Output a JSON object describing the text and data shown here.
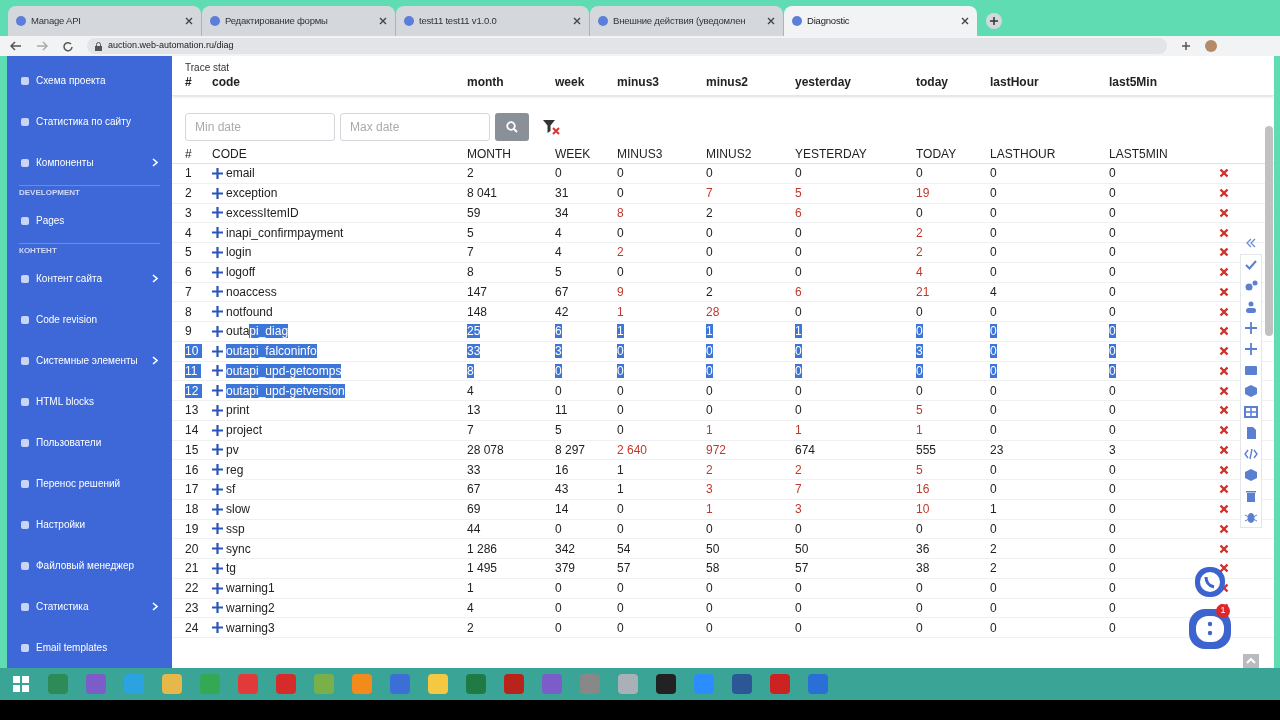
{
  "browser": {
    "tabs": [
      {
        "title": "Manage API",
        "selected": false
      },
      {
        "title": "Редактирование формы",
        "selected": false
      },
      {
        "title": "test11 test11 v1.0.0",
        "selected": false
      },
      {
        "title": "Внешние действия (уведомлен",
        "selected": false
      },
      {
        "title": "Diagnostic",
        "selected": true
      }
    ],
    "address": "auction.web-automation.ru/diag"
  },
  "sidebar": {
    "items": [
      {
        "kind": "link",
        "label": "Схема проекта",
        "submenu": false
      },
      {
        "kind": "link",
        "label": "Статистика по сайту",
        "submenu": false
      },
      {
        "kind": "link",
        "label": "Компоненты",
        "submenu": true
      },
      {
        "kind": "header",
        "label": "DEVELOPMENT"
      },
      {
        "kind": "link",
        "label": "Pages",
        "submenu": false
      },
      {
        "kind": "header",
        "label": "КОНТЕНТ"
      },
      {
        "kind": "link",
        "label": "Контент сайта",
        "submenu": true
      },
      {
        "kind": "link",
        "label": "Code revision",
        "submenu": false
      },
      {
        "kind": "link",
        "label": "Системные элементы",
        "submenu": true
      },
      {
        "kind": "link",
        "label": "HTML blocks",
        "submenu": false
      },
      {
        "kind": "link",
        "label": "Пользователи",
        "submenu": false
      },
      {
        "kind": "link",
        "label": "Перенос решений",
        "submenu": false
      },
      {
        "kind": "link",
        "label": "Настройки",
        "submenu": false
      },
      {
        "kind": "link",
        "label": "Файловый менеджер",
        "submenu": false
      },
      {
        "kind": "link",
        "label": "Статистика",
        "submenu": true
      },
      {
        "kind": "link",
        "label": "Email templates",
        "submenu": false
      }
    ]
  },
  "sticky_header": {
    "title": "Trace stat",
    "columns": [
      "#",
      "code",
      "month",
      "week",
      "minus3",
      "minus2",
      "yesterday",
      "today",
      "lastHour",
      "last5Min"
    ]
  },
  "filters": {
    "min_date": {
      "placeholder": "Min date"
    },
    "max_date": {
      "placeholder": "Max date"
    }
  },
  "table": {
    "columns": [
      "#",
      "CODE",
      "MONTH",
      "WEEK",
      "MINUS3",
      "MINUS2",
      "YESTERDAY",
      "TODAY",
      "LASTHOUR",
      "LAST5MIN"
    ],
    "rows": [
      {
        "num": "1",
        "num_selected": false,
        "code": [
          {
            "text": "email",
            "selected": false
          }
        ],
        "values": [
          "2",
          "0",
          "0",
          "0",
          "0",
          "0",
          "0",
          "0"
        ],
        "warn": [
          false,
          false,
          false,
          false,
          false,
          false,
          false,
          false
        ],
        "values_selected": false
      },
      {
        "num": "2",
        "num_selected": false,
        "code": [
          {
            "text": "exception",
            "selected": false
          }
        ],
        "values": [
          "8 041",
          "31",
          "0",
          "7",
          "5",
          "19",
          "0",
          "0"
        ],
        "warn": [
          false,
          false,
          false,
          true,
          true,
          true,
          false,
          false
        ],
        "values_selected": false
      },
      {
        "num": "3",
        "num_selected": false,
        "code": [
          {
            "text": "excessItemID",
            "selected": false
          }
        ],
        "values": [
          "59",
          "34",
          "8",
          "2",
          "6",
          "0",
          "0",
          "0"
        ],
        "warn": [
          false,
          false,
          true,
          false,
          true,
          false,
          false,
          false
        ],
        "values_selected": false
      },
      {
        "num": "4",
        "num_selected": false,
        "code": [
          {
            "text": "inapi_confirmpayment",
            "selected": false
          }
        ],
        "values": [
          "5",
          "4",
          "0",
          "0",
          "0",
          "2",
          "0",
          "0"
        ],
        "warn": [
          false,
          false,
          false,
          false,
          false,
          true,
          false,
          false
        ],
        "values_selected": false
      },
      {
        "num": "5",
        "num_selected": false,
        "code": [
          {
            "text": "login",
            "selected": false
          }
        ],
        "values": [
          "7",
          "4",
          "2",
          "0",
          "0",
          "2",
          "0",
          "0"
        ],
        "warn": [
          false,
          false,
          true,
          false,
          false,
          true,
          false,
          false
        ],
        "values_selected": false
      },
      {
        "num": "6",
        "num_selected": false,
        "code": [
          {
            "text": "logoff",
            "selected": false
          }
        ],
        "values": [
          "8",
          "5",
          "0",
          "0",
          "0",
          "4",
          "0",
          "0"
        ],
        "warn": [
          false,
          false,
          false,
          false,
          false,
          true,
          false,
          false
        ],
        "values_selected": false
      },
      {
        "num": "7",
        "num_selected": false,
        "code": [
          {
            "text": "noaccess",
            "selected": false
          }
        ],
        "values": [
          "147",
          "67",
          "9",
          "2",
          "6",
          "21",
          "4",
          "0"
        ],
        "warn": [
          false,
          false,
          true,
          false,
          true,
          true,
          false,
          false
        ],
        "values_selected": false
      },
      {
        "num": "8",
        "num_selected": false,
        "code": [
          {
            "text": "notfound",
            "selected": false
          }
        ],
        "values": [
          "148",
          "42",
          "1",
          "28",
          "0",
          "0",
          "0",
          "0"
        ],
        "warn": [
          false,
          false,
          true,
          true,
          false,
          false,
          false,
          false
        ],
        "values_selected": false
      },
      {
        "num": "9",
        "num_selected": false,
        "code": [
          {
            "text": "outa",
            "selected": false
          },
          {
            "text": "pi_diag",
            "selected": true
          }
        ],
        "values": [
          "25",
          "6",
          "1",
          "1",
          "1",
          "0",
          "0",
          "0"
        ],
        "warn": [
          false,
          false,
          false,
          false,
          false,
          false,
          false,
          false
        ],
        "values_selected": true
      },
      {
        "num": "10",
        "num_selected": true,
        "code": [
          {
            "text": "outapi_falconinfo",
            "selected": true
          }
        ],
        "values": [
          "33",
          "3",
          "0",
          "0",
          "0",
          "3",
          "0",
          "0"
        ],
        "warn": [
          false,
          false,
          false,
          false,
          false,
          false,
          false,
          false
        ],
        "values_selected": true
      },
      {
        "num": "11",
        "num_selected": true,
        "code": [
          {
            "text": "outapi_upd-getcomps",
            "selected": true
          }
        ],
        "values": [
          "8",
          "0",
          "0",
          "0",
          "0",
          "0",
          "0",
          "0"
        ],
        "warn": [
          false,
          false,
          false,
          false,
          false,
          false,
          false,
          false
        ],
        "values_selected": true
      },
      {
        "num": "12",
        "num_selected": true,
        "code": [
          {
            "text": "outapi_upd-getversion",
            "selected": true
          }
        ],
        "values": [
          "4",
          "0",
          "0",
          "0",
          "0",
          "0",
          "0",
          "0"
        ],
        "warn": [
          false,
          false,
          false,
          false,
          false,
          false,
          false,
          false
        ],
        "values_selected": false
      },
      {
        "num": "13",
        "num_selected": false,
        "code": [
          {
            "text": "print",
            "selected": false
          }
        ],
        "values": [
          "13",
          "11",
          "0",
          "0",
          "0",
          "5",
          "0",
          "0"
        ],
        "warn": [
          false,
          false,
          false,
          false,
          false,
          true,
          false,
          false
        ],
        "values_selected": false
      },
      {
        "num": "14",
        "num_selected": false,
        "code": [
          {
            "text": "project",
            "selected": false
          }
        ],
        "values": [
          "7",
          "5",
          "0",
          "1",
          "1",
          "1",
          "0",
          "0"
        ],
        "warn": [
          false,
          false,
          false,
          true,
          true,
          true,
          false,
          false
        ],
        "values_selected": false
      },
      {
        "num": "15",
        "num_selected": false,
        "code": [
          {
            "text": "pv",
            "selected": false
          }
        ],
        "values": [
          "28 078",
          "8 297",
          "2 640",
          "972",
          "674",
          "555",
          "23",
          "3"
        ],
        "warn": [
          false,
          false,
          true,
          true,
          false,
          false,
          false,
          false
        ],
        "values_selected": false
      },
      {
        "num": "16",
        "num_selected": false,
        "code": [
          {
            "text": "reg",
            "selected": false
          }
        ],
        "values": [
          "33",
          "16",
          "1",
          "2",
          "2",
          "5",
          "0",
          "0"
        ],
        "warn": [
          false,
          false,
          false,
          true,
          true,
          true,
          false,
          false
        ],
        "values_selected": false
      },
      {
        "num": "17",
        "num_selected": false,
        "code": [
          {
            "text": "sf",
            "selected": false
          }
        ],
        "values": [
          "67",
          "43",
          "1",
          "3",
          "7",
          "16",
          "0",
          "0"
        ],
        "warn": [
          false,
          false,
          false,
          true,
          true,
          true,
          false,
          false
        ],
        "values_selected": false
      },
      {
        "num": "18",
        "num_selected": false,
        "code": [
          {
            "text": "slow",
            "selected": false
          }
        ],
        "values": [
          "69",
          "14",
          "0",
          "1",
          "3",
          "10",
          "1",
          "0"
        ],
        "warn": [
          false,
          false,
          false,
          true,
          true,
          true,
          false,
          false
        ],
        "values_selected": false
      },
      {
        "num": "19",
        "num_selected": false,
        "code": [
          {
            "text": "ssp",
            "selected": false
          }
        ],
        "values": [
          "44",
          "0",
          "0",
          "0",
          "0",
          "0",
          "0",
          "0"
        ],
        "warn": [
          false,
          false,
          false,
          false,
          false,
          false,
          false,
          false
        ],
        "values_selected": false
      },
      {
        "num": "20",
        "num_selected": false,
        "code": [
          {
            "text": "sync",
            "selected": false
          }
        ],
        "values": [
          "1 286",
          "342",
          "54",
          "50",
          "50",
          "36",
          "2",
          "0"
        ],
        "warn": [
          false,
          false,
          false,
          false,
          false,
          false,
          false,
          false
        ],
        "values_selected": false
      },
      {
        "num": "21",
        "num_selected": false,
        "code": [
          {
            "text": "tg",
            "selected": false
          }
        ],
        "values": [
          "1 495",
          "379",
          "57",
          "58",
          "57",
          "38",
          "2",
          "0"
        ],
        "warn": [
          false,
          false,
          false,
          false,
          false,
          false,
          false,
          false
        ],
        "values_selected": false
      },
      {
        "num": "22",
        "num_selected": false,
        "code": [
          {
            "text": "warning1",
            "selected": false
          }
        ],
        "values": [
          "1",
          "0",
          "0",
          "0",
          "0",
          "0",
          "0",
          "0"
        ],
        "warn": [
          false,
          false,
          false,
          false,
          false,
          false,
          false,
          false
        ],
        "values_selected": false
      },
      {
        "num": "23",
        "num_selected": false,
        "code": [
          {
            "text": "warning2",
            "selected": false
          }
        ],
        "values": [
          "4",
          "0",
          "0",
          "0",
          "0",
          "0",
          "0",
          "0"
        ],
        "warn": [
          false,
          false,
          false,
          false,
          false,
          false,
          false,
          false
        ],
        "values_selected": false
      },
      {
        "num": "24",
        "num_selected": false,
        "code": [
          {
            "text": "warning3",
            "selected": false
          }
        ],
        "values": [
          "2",
          "0",
          "0",
          "0",
          "0",
          "0",
          "0",
          "0"
        ],
        "warn": [
          false,
          false,
          false,
          false,
          false,
          false,
          false,
          false
        ],
        "values_selected": false
      }
    ]
  },
  "chat": {
    "badge": "1"
  }
}
